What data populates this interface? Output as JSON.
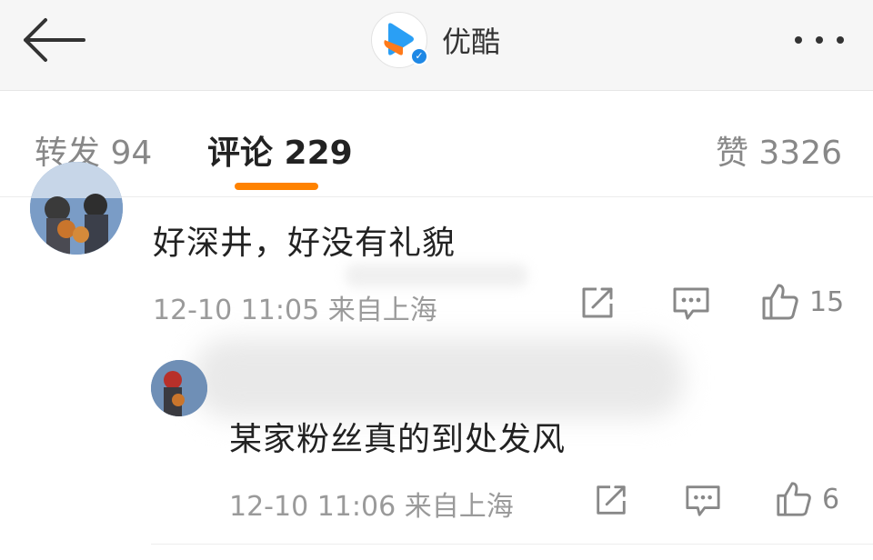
{
  "header": {
    "back_icon": "arrow-left-icon",
    "account_name": "优酷",
    "verified_icon": "verified-badge-icon",
    "more_icon": "more-horizontal-icon"
  },
  "tabs": {
    "reposts": "转发 94",
    "comments": "评论 229",
    "likes": "赞 3326",
    "active_color": "#ff8200"
  },
  "comments": [
    {
      "text": "好深井，好没有礼貌",
      "meta": "12-10 11:05  来自上海",
      "like_count": "15"
    },
    {
      "text": "某家粉丝真的到处发风",
      "meta": "12-10 11:06  来自上海",
      "like_count": "6"
    }
  ],
  "icons": {
    "share": "share-icon",
    "reply": "comment-icon",
    "like": "thumbs-up-icon"
  }
}
